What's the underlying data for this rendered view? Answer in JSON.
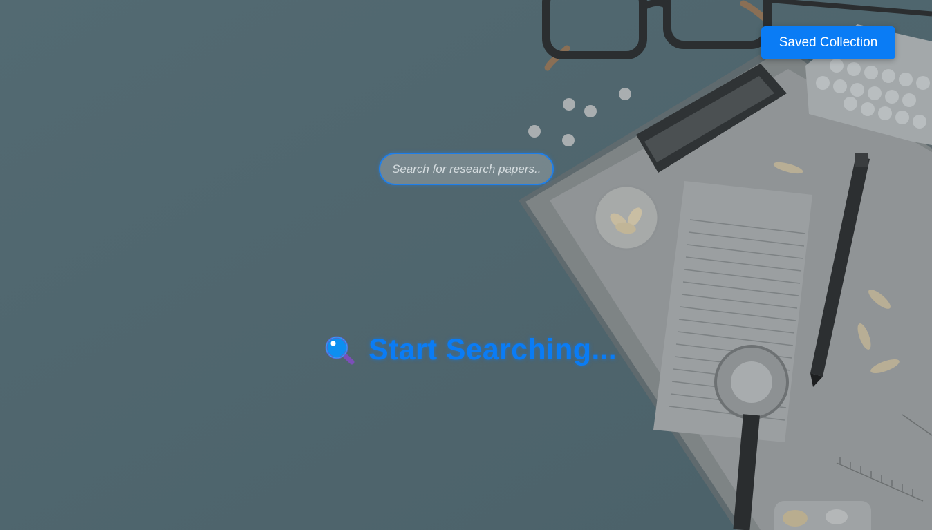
{
  "header": {
    "saved_collection_label": "Saved Collection"
  },
  "search": {
    "placeholder": "Search for research papers..",
    "value": ""
  },
  "empty_state": {
    "icon": "magnifier-icon",
    "message": "Start Searching..."
  },
  "colors": {
    "accent": "#0a7cf5",
    "background": "#4f6770"
  }
}
